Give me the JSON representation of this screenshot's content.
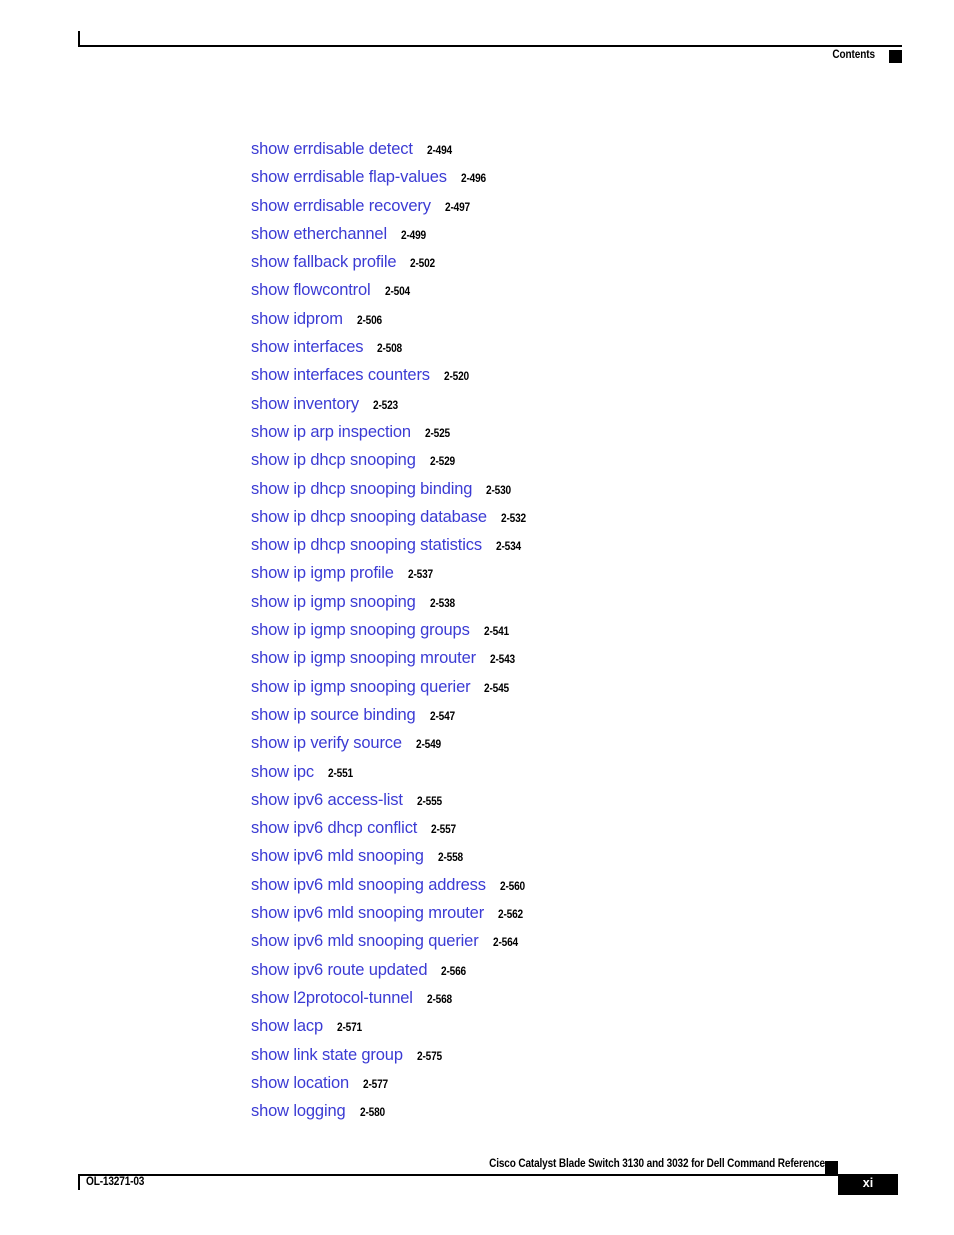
{
  "header": {
    "title": "Contents",
    "marker": "black-square"
  },
  "toc": {
    "entries": [
      {
        "title": "show errdisable detect",
        "page": "2-494"
      },
      {
        "title": "show errdisable flap-values",
        "page": "2-496"
      },
      {
        "title": "show errdisable recovery",
        "page": "2-497"
      },
      {
        "title": "show etherchannel",
        "page": "2-499"
      },
      {
        "title": "show fallback profile",
        "page": "2-502"
      },
      {
        "title": "show flowcontrol",
        "page": "2-504"
      },
      {
        "title": "show idprom",
        "page": "2-506"
      },
      {
        "title": "show interfaces",
        "page": "2-508"
      },
      {
        "title": "show interfaces counters",
        "page": "2-520"
      },
      {
        "title": "show inventory",
        "page": "2-523"
      },
      {
        "title": "show ip arp inspection",
        "page": "2-525"
      },
      {
        "title": "show ip dhcp snooping",
        "page": "2-529"
      },
      {
        "title": "show ip dhcp snooping binding",
        "page": "2-530"
      },
      {
        "title": "show ip dhcp snooping database",
        "page": "2-532"
      },
      {
        "title": "show ip dhcp snooping statistics",
        "page": "2-534"
      },
      {
        "title": "show ip igmp profile",
        "page": "2-537"
      },
      {
        "title": "show ip igmp snooping",
        "page": "2-538"
      },
      {
        "title": "show ip igmp snooping groups",
        "page": "2-541"
      },
      {
        "title": "show ip igmp snooping mrouter",
        "page": "2-543"
      },
      {
        "title": "show ip igmp snooping querier",
        "page": "2-545"
      },
      {
        "title": "show ip source binding",
        "page": "2-547"
      },
      {
        "title": "show ip verify source",
        "page": "2-549"
      },
      {
        "title": "show ipc",
        "page": "2-551"
      },
      {
        "title": "show ipv6 access-list",
        "page": "2-555"
      },
      {
        "title": "show ipv6 dhcp conflict",
        "page": "2-557"
      },
      {
        "title": "show ipv6 mld snooping",
        "page": "2-558"
      },
      {
        "title": "show ipv6 mld snooping address",
        "page": "2-560"
      },
      {
        "title": "show ipv6 mld snooping mrouter",
        "page": "2-562"
      },
      {
        "title": "show ipv6 mld snooping querier",
        "page": "2-564"
      },
      {
        "title": "show ipv6 route updated",
        "page": "2-566"
      },
      {
        "title": "show l2protocol-tunnel",
        "page": "2-568"
      },
      {
        "title": "show lacp",
        "page": "2-571"
      },
      {
        "title": "show link state group",
        "page": "2-575"
      },
      {
        "title": "show location",
        "page": "2-577"
      },
      {
        "title": "show logging",
        "page": "2-580"
      }
    ]
  },
  "footer": {
    "doc_title": "Cisco Catalyst Blade Switch 3130 and 3032 for Dell Command Reference",
    "doc_number": "OL-13271-03",
    "page_number": "xi"
  },
  "colors": {
    "link_blue": "#3b3bd4",
    "text_black": "#000000",
    "page_background": "#ffffff"
  }
}
